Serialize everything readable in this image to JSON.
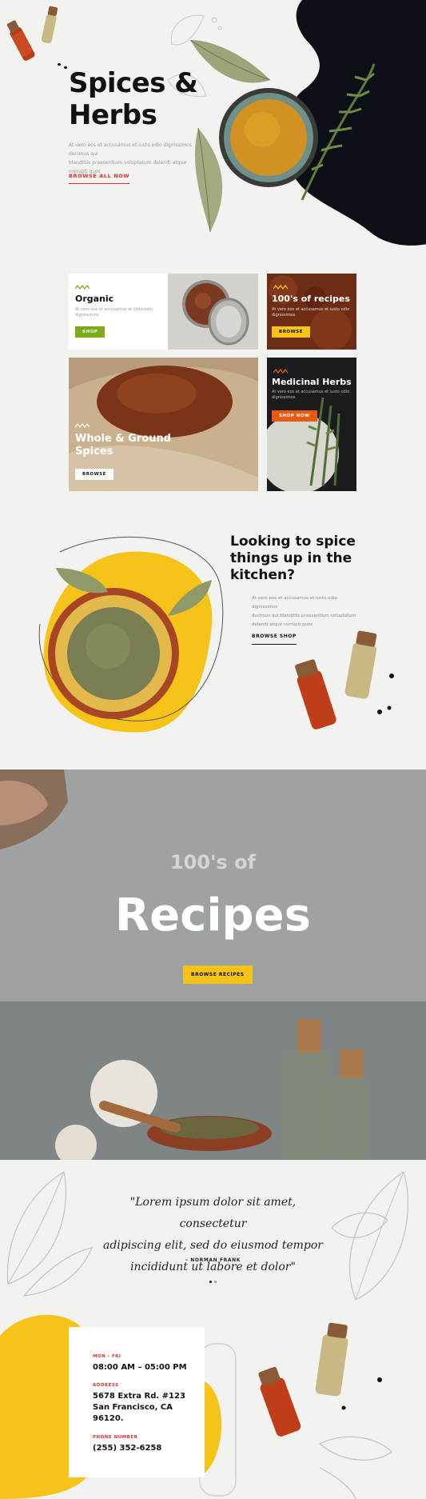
{
  "colors": {
    "background": "#f2f2f0",
    "dark": "#0d0f17",
    "accent_red": "#d7312b",
    "accent_yellow": "#f6c318",
    "accent_green": "#7cab1c",
    "accent_orange": "#e95a10"
  },
  "hero": {
    "title_line1": "Spices &",
    "title_line2": "Herbs",
    "text_line1": "At vero eos et accusamus et iusto odio dignissimos ducimus qui",
    "text_line2": "blanditiis praesentium voluptatum deleniti atque corrupti quos",
    "link_label": "BROWSE ALL NOW"
  },
  "cards": {
    "organic": {
      "title": "Organic",
      "desc_line1": "At vero eos et accusamus et iusto odio",
      "desc_line2": "dignissimos",
      "button": "SHOP"
    },
    "recipes": {
      "title": "100's of recipes",
      "desc_line1": "At vero eos et accusamus et iusto odio",
      "desc_line2": "dignissimos",
      "button": "BROWSE"
    },
    "whole": {
      "title_line1": "Whole & Ground",
      "title_line2": "Spices",
      "button": "BROWSE"
    },
    "medicinal": {
      "title": "Medicinal Herbs",
      "desc_line1": "At vero eos et accusamus et iusto odio",
      "desc_line2": "dignissimos",
      "button": "SHOP NOW"
    }
  },
  "spice_section": {
    "title_line1": "Looking to spice",
    "title_line2": "things up in the",
    "title_line3": "kitchen?",
    "text_line1": "At vero eos et accusamus et iusto odio dignissimos",
    "text_line2": "ducimus qui blanditiis praesentium voluptatum",
    "text_line3": "deleniti atque corrupti quos",
    "link_label": "BROWSE SHOP"
  },
  "recipes_banner": {
    "pretitle": "100's of",
    "title": "Recipes",
    "button": "BROWSE RECIPES"
  },
  "testimonial": {
    "quote_line1": "\"Lorem ipsum dolor sit amet, consectetur",
    "quote_line2": "adipiscing elit, sed do eiusmod tempor",
    "quote_line3": "incididunt ut labore et dolor\"",
    "author": "– NORMAN FRANK"
  },
  "contact": {
    "hours_label": "MON - FRI",
    "hours_value": "08:00 AM – 05:00 PM",
    "address_label": "ADDRESS",
    "address_line1": "5678 Extra Rd. #123",
    "address_line2": "San Francisco, CA",
    "address_line3": "96120.",
    "phone_label": "PHONE NUMBER",
    "phone_value": "(255) 352-6258"
  }
}
